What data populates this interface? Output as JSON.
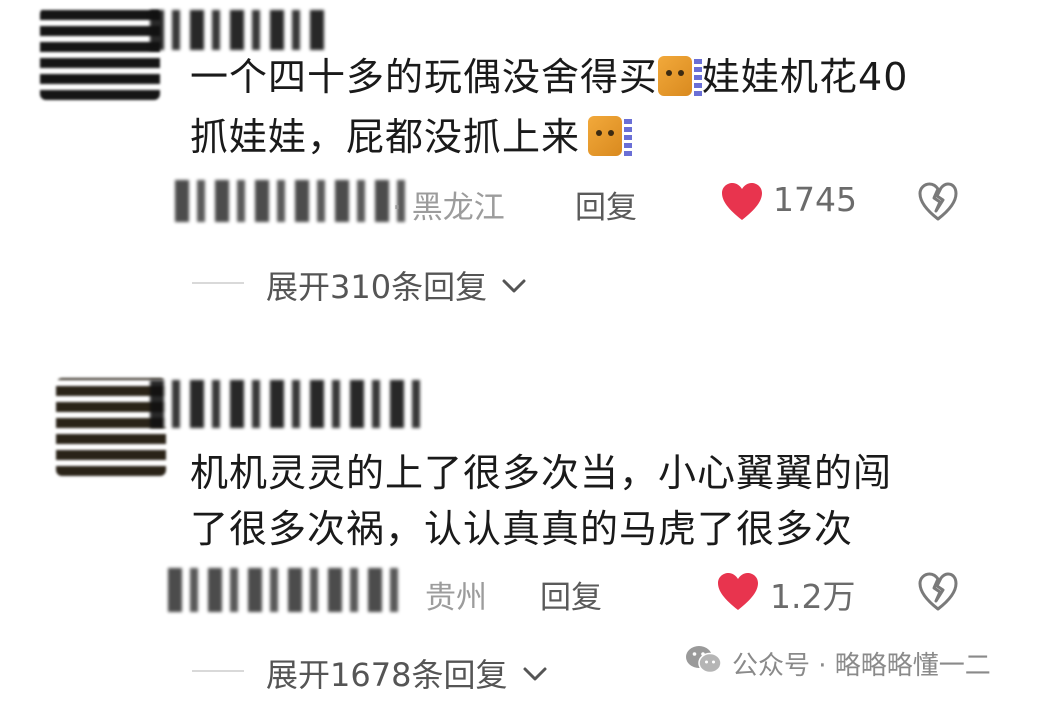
{
  "comments": [
    {
      "text_line1_a": "一个四十多的玩偶没舍得买",
      "text_line1_b": "娃娃机花40",
      "text_line2": "抓娃娃，屁都没抓上来",
      "location": "· 黑龙江",
      "reply_label": "回复",
      "likes": "1745",
      "expand_label": "展开310条回复",
      "emoji_1": "cat-face-emoji",
      "emoji_2": "cat-face-emoji"
    },
    {
      "text_line1": "机机灵灵的上了很多次当，小心翼翼的闯",
      "text_line2": "了很多次祸，认认真真的马虎了很多次",
      "location": "贵州",
      "reply_label": "回复",
      "likes": "1.2万",
      "expand_label": "展开1678条回复"
    }
  ],
  "watermark": {
    "label": "公众号 · 略略略懂一二",
    "icon": "wechat-icon"
  },
  "colors": {
    "like_heart": "#e8344e",
    "text": "#1a1a1a",
    "meta": "#9c9c9c"
  }
}
